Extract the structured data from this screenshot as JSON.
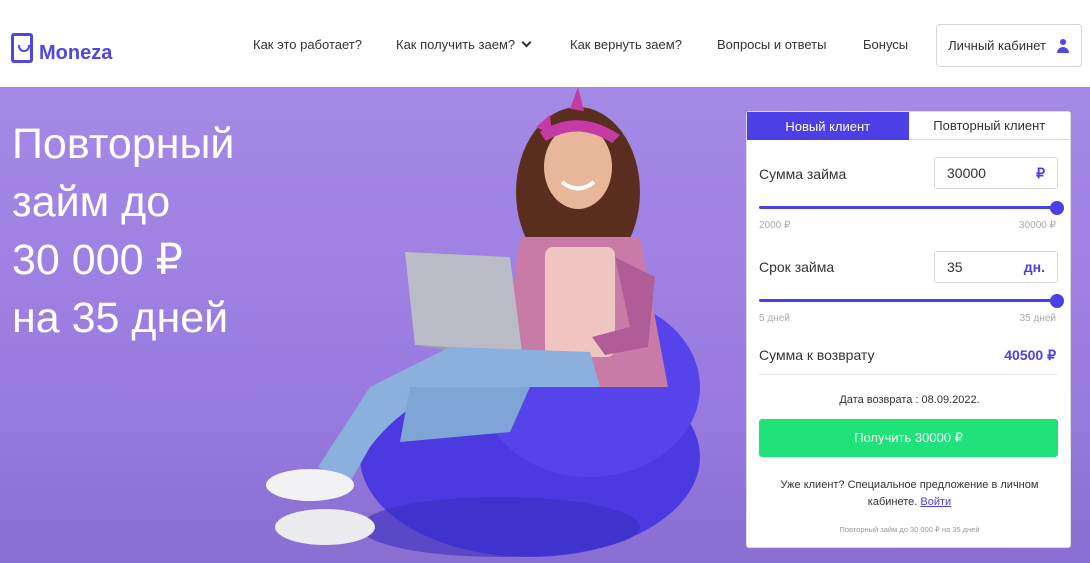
{
  "brand": {
    "name": "Moneza",
    "accent": "#5046e6",
    "cta_color": "#1fe37a"
  },
  "nav": {
    "items": [
      {
        "label": "Как это работает?"
      },
      {
        "label": "Как получить заем?",
        "has_dropdown": true
      },
      {
        "label": "Как вернуть заем?"
      },
      {
        "label": "Вопросы и ответы"
      },
      {
        "label": "Бонусы"
      }
    ],
    "cabinet_label": "Личный кабинет"
  },
  "hero": {
    "headline_lines": [
      "Повторный",
      "займ до",
      "30 000 ₽",
      "на 35 дней"
    ]
  },
  "calculator": {
    "tabs": {
      "new_client": "Новый клиент",
      "returning_client": "Повторный клиент",
      "active": "new_client"
    },
    "amount": {
      "label": "Сумма займа",
      "value": "30000",
      "unit": "₽",
      "min_label": "2000 ₽",
      "max_label": "30000 ₽",
      "level": 1.0
    },
    "term": {
      "label": "Срок займа",
      "value": "35",
      "unit": "дн.",
      "min_label": "5 дней",
      "max_label": "35 дней",
      "level": 1.0
    },
    "repay": {
      "label": "Сумма к возврату",
      "value": "40500 ₽"
    },
    "return_date": "Дата возврата : 08.09.2022.",
    "submit_label": "Получить 30000 ₽",
    "promo_text": "Уже клиент? Специальное предложение в личном кабинете.",
    "promo_link": "Войти",
    "footnote": "Повторный займ до 30 000 ₽ на 35 дней"
  }
}
